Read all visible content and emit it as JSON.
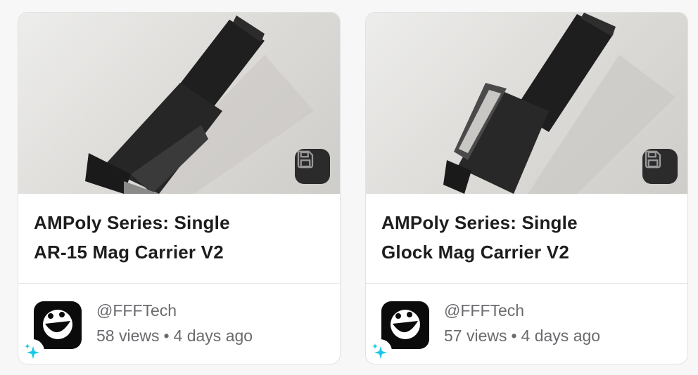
{
  "cards": [
    {
      "title_line1": "AMPoly Series: Single",
      "title_line2": "AR-15 Mag Carrier V2",
      "author": "@FFFTech",
      "views": "58 views",
      "separator": "•",
      "age": "4 days ago",
      "thumbnail_icon": "product-photo",
      "save_icon": "save-icon"
    },
    {
      "title_line1": "AMPoly Series: Single",
      "title_line2": "Glock Mag Carrier V2",
      "author": "@FFFTech",
      "views": "57 views",
      "separator": "•",
      "age": "4 days ago",
      "thumbnail_icon": "product-photo",
      "save_icon": "save-icon"
    }
  ],
  "colors": {
    "save_button_bg": "#2b2b2b",
    "sparkle": "#19c8e6",
    "text_muted": "#6b6b6f",
    "title": "#1d1d1f"
  }
}
